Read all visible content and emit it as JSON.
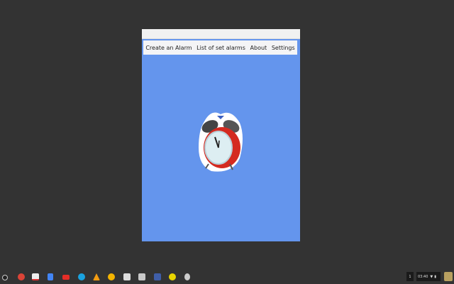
{
  "menu": {
    "items": [
      "Create an Alarm",
      "List of set alarms",
      "About",
      "Settings"
    ]
  },
  "tray": {
    "notification_count": "1",
    "time": "03:40"
  },
  "shelf": {
    "apps": [
      "launcher",
      "chrome",
      "gmail",
      "docs",
      "youtube",
      "chat",
      "vlc",
      "photos",
      "files",
      "app",
      "calculator",
      "emoji",
      "alarm"
    ]
  },
  "colors": {
    "app_bg": "#6495ed",
    "desktop": "#333333"
  }
}
